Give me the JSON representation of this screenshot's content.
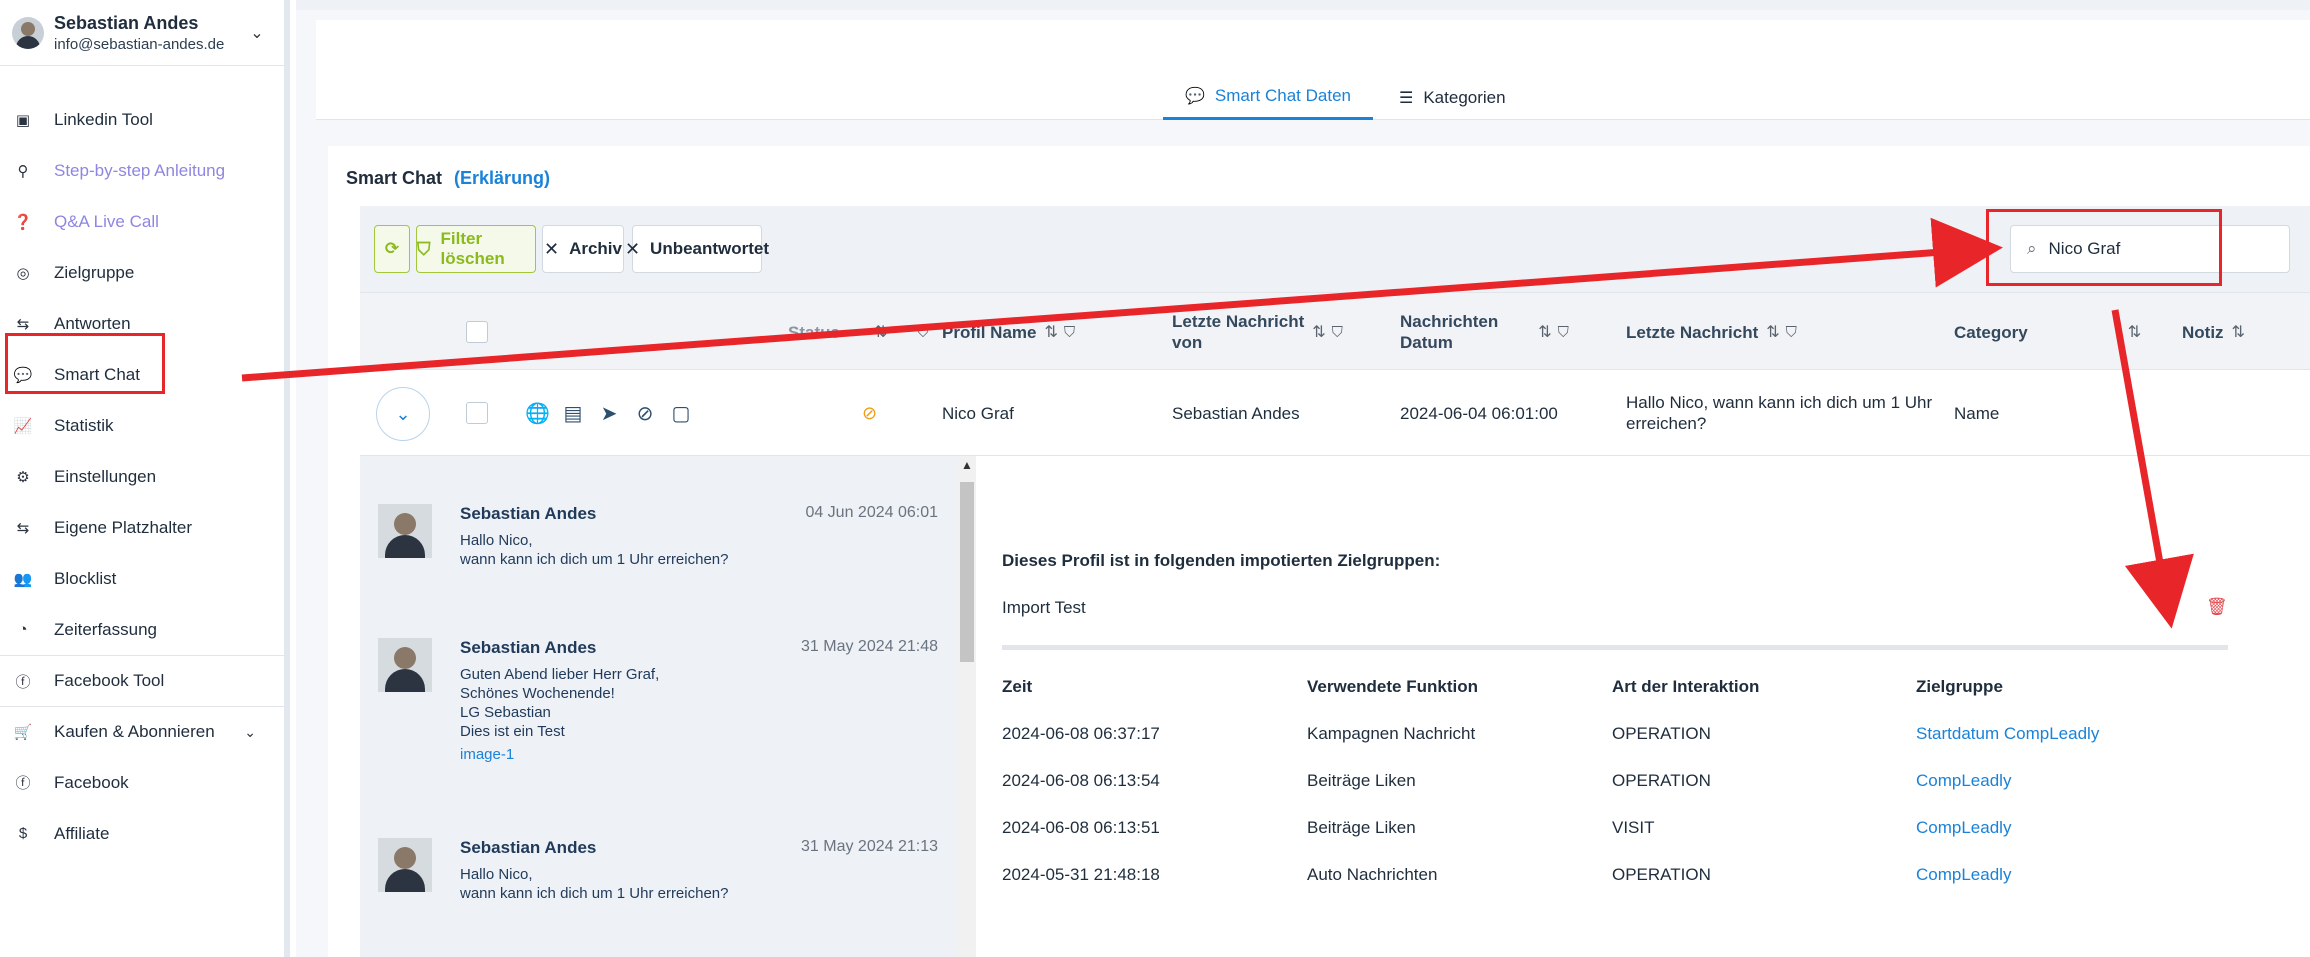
{
  "user": {
    "name": "Sebastian Andes",
    "email": "info@sebastian-andes.de"
  },
  "sidebar": {
    "items": [
      {
        "label": "Linkedin Tool",
        "icon": "linkedin-icon",
        "glyph": "▣"
      },
      {
        "label": "Step-by-step Anleitung",
        "icon": "steps-icon",
        "glyph": "⚲"
      },
      {
        "label": "Q&A Live Call",
        "icon": "question-icon",
        "glyph": "?"
      },
      {
        "label": "Zielgruppe",
        "icon": "target-icon",
        "glyph": "◎"
      },
      {
        "label": "Antworten",
        "icon": "reply-icon",
        "glyph": "⇆"
      },
      {
        "label": "Smart Chat",
        "icon": "chat-icon",
        "glyph": "💬"
      },
      {
        "label": "Statistik",
        "icon": "chart-icon",
        "glyph": "📈"
      },
      {
        "label": "Einstellungen",
        "icon": "gear-icon",
        "glyph": "⚙"
      },
      {
        "label": "Eigene Platzhalter",
        "icon": "placeholder-icon",
        "glyph": "⇆"
      },
      {
        "label": "Blocklist",
        "icon": "users-icon",
        "glyph": "👥"
      },
      {
        "label": "Zeiterfassung",
        "icon": "clock-icon",
        "glyph": "◔"
      },
      {
        "label": "Facebook Tool",
        "icon": "facebook-icon",
        "glyph": "f"
      },
      {
        "label": "Kaufen & Abonnieren",
        "icon": "cart-icon",
        "glyph": "🛒"
      },
      {
        "label": "Facebook",
        "icon": "facebook-icon",
        "glyph": "f"
      },
      {
        "label": "Affiliate",
        "icon": "dollar-icon",
        "glyph": "$"
      }
    ]
  },
  "tabs": {
    "smart_chat": "Smart Chat Daten",
    "kategorien": "Kategorien"
  },
  "card": {
    "title": "Smart Chat",
    "link": "(Erklärung)"
  },
  "toolbar": {
    "refresh_icon": "refresh-icon",
    "filter_label": "Filter löschen",
    "archiv_label": "Archiv",
    "unbeantwortet_label": "Unbeantwortet"
  },
  "search": {
    "value": "Nico Graf"
  },
  "table": {
    "headers": {
      "status": "Status",
      "profil_name": "Profil Name",
      "letzte_von_1": "Letzte Nachricht",
      "letzte_von_2": "von",
      "datum_1": "Nachrichten",
      "datum_2": "Datum",
      "letzte": "Letzte Nachricht",
      "category": "Category",
      "notiz": "Notiz"
    },
    "row": {
      "profil_name": "Nico Graf",
      "von": "Sebastian Andes",
      "datum": "2024-06-04 06:01:00",
      "letzte_1": "Hallo Nico, wann kann ich dich um 1 Uhr",
      "letzte_2": "erreichen?",
      "category": "Name"
    }
  },
  "chat": {
    "messages": [
      {
        "name": "Sebastian Andes",
        "date": "04 Jun 2024 06:01",
        "text": "Hallo Nico,\nwann kann ich dich um 1 Uhr erreichen?",
        "link": ""
      },
      {
        "name": "Sebastian Andes",
        "date": "31 May 2024 21:48",
        "text": "Guten Abend lieber Herr Graf,\nSchönes Wochenende!\nLG Sebastian\nDies ist ein Test",
        "link": "image-1"
      },
      {
        "name": "Sebastian Andes",
        "date": "31 May 2024 21:13",
        "text": "Hallo Nico,\nwann kann ich dich um 1 Uhr erreichen?",
        "link": ""
      }
    ]
  },
  "profile": {
    "title": "Dieses Profil ist in folgenden impotierten Zielgruppen:",
    "import": "Import Test",
    "headers": {
      "zeit": "Zeit",
      "funktion": "Verwendete Funktion",
      "art": "Art der Interaktion",
      "zielgruppe": "Zielgruppe"
    },
    "rows": [
      {
        "zeit": "2024-06-08 06:37:17",
        "funktion": "Kampagnen Nachricht",
        "art": "OPERATION",
        "zielgruppe": "Startdatum CompLeadly"
      },
      {
        "zeit": "2024-06-08 06:13:54",
        "funktion": "Beiträge Liken",
        "art": "OPERATION",
        "zielgruppe": "CompLeadly"
      },
      {
        "zeit": "2024-06-08 06:13:51",
        "funktion": "Beiträge Liken",
        "art": "VISIT",
        "zielgruppe": "CompLeadly"
      },
      {
        "zeit": "2024-05-31 21:48:18",
        "funktion": "Auto Nachrichten",
        "art": "OPERATION",
        "zielgruppe": "CompLeadly"
      }
    ]
  },
  "colors": {
    "accent": "#1a82d8",
    "annotation": "#e8262a",
    "green": "#8aba1c"
  }
}
